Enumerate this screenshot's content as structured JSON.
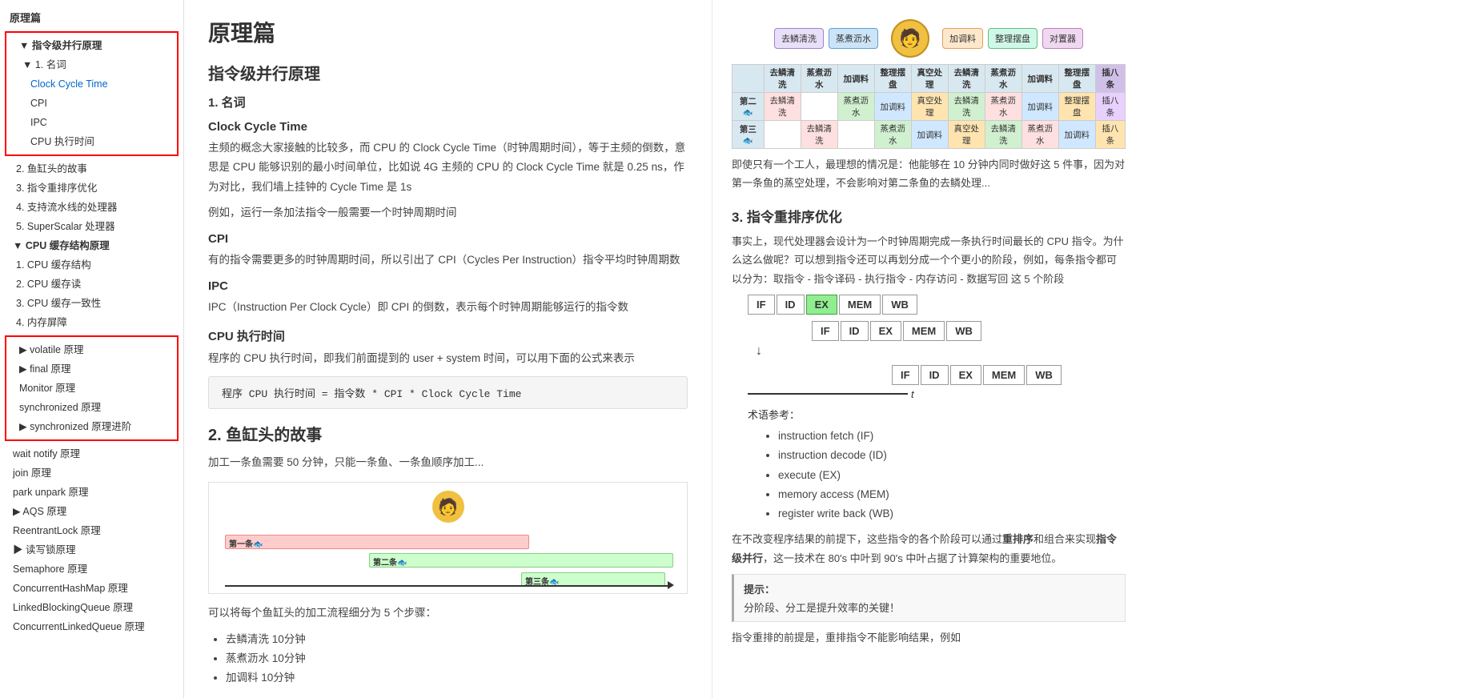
{
  "sidebar": {
    "top_title": "原理篇",
    "groups": [
      {
        "type": "outlined",
        "items": [
          {
            "label": "▼ 指令级并行原理",
            "indent": 0,
            "bold": true
          },
          {
            "label": "▼ 1. 名词",
            "indent": 1
          },
          {
            "label": "Clock Cycle Time",
            "indent": 2,
            "active": true
          },
          {
            "label": "CPI",
            "indent": 2
          },
          {
            "label": "IPC",
            "indent": 2
          },
          {
            "label": "CPU 执行时间",
            "indent": 2
          }
        ]
      }
    ],
    "plain_items": [
      {
        "label": "2. 鱼缸头的故事",
        "indent": 1
      },
      {
        "label": "3. 指令重排序优化",
        "indent": 1
      },
      {
        "label": "4. 支持流水线的处理器",
        "indent": 1
      },
      {
        "label": "5. SuperScalar 处理器",
        "indent": 1
      }
    ],
    "cpu_section": {
      "title": "▼ CPU 缓存结构原理",
      "items": [
        {
          "label": "1. CPU 缓存结构",
          "indent": 1
        },
        {
          "label": "2. CPU 缓存读",
          "indent": 1
        },
        {
          "label": "3. CPU 缓存一致性",
          "indent": 1
        },
        {
          "label": "4. 内存屏障",
          "indent": 1
        }
      ]
    },
    "outlined2_items": [
      {
        "label": "▶ volatile 原理",
        "indent": 0
      },
      {
        "label": "▶ final 原理",
        "indent": 0
      },
      {
        "label": "Monitor 原理",
        "indent": 0
      },
      {
        "label": "synchronized 原理",
        "indent": 0
      },
      {
        "label": "▶ synchronized 原理进阶",
        "indent": 0
      }
    ],
    "bottom_items": [
      {
        "label": "wait notify 原理",
        "indent": 0
      },
      {
        "label": "join 原理",
        "indent": 0
      },
      {
        "label": "park unpark 原理",
        "indent": 0
      },
      {
        "label": "▶ AQS 原理",
        "indent": 0
      },
      {
        "label": "ReentrantLock 原理",
        "indent": 0
      },
      {
        "label": "▶ 读写锁原理",
        "indent": 0
      },
      {
        "label": "Semaphore 原理",
        "indent": 0
      },
      {
        "label": "ConcurrentHashMap 原理",
        "indent": 0
      },
      {
        "label": "LinkedBlockingQueue 原理",
        "indent": 0
      },
      {
        "label": "ConcurrentLinkedQueue 原理",
        "indent": 0
      }
    ]
  },
  "main": {
    "page_title": "原理篇",
    "article_title": "指令级并行原理",
    "section1_title": "1. 名词",
    "sub1_title": "Clock Cycle Time",
    "sub1_para1": "主频的概念大家接触的比较多，而 CPU 的 Clock Cycle Time（时钟周期时间），等于主频的倒数，意思是 CPU 能够识别的最小时间单位，比如说 4G 主频的 CPU 的 Clock Cycle Time 就是 0.25 ns，作为对比，我们墙上挂钟的 Cycle Time 是 1s",
    "sub1_para2": "例如，运行一条加法指令一般需要一个时钟周期时间",
    "sub2_title": "CPI",
    "sub2_para": "有的指令需要更多的时钟周期时间，所以引出了 CPI（Cycles Per Instruction）指令平均时钟周期数",
    "sub3_title": "IPC",
    "sub3_para": "IPC（Instruction Per Clock Cycle）即 CPI 的倒数，表示每个时钟周期能够运行的指令数",
    "sub4_title": "CPU 执行时间",
    "sub4_para": "程序的 CPU 执行时间，即我们前面提到的 user + system 时间，可以用下面的公式来表示",
    "code_formula": "程序 CPU 执行时间 = 指令数 * CPI * Clock Cycle Time",
    "section2_title": "2. 鱼缸头的故事",
    "section2_para": "加工一条鱼需要 50 分钟，只能一条鱼、一条鱼顺序加工...",
    "bar1_label": "第一条🐟",
    "bar2_label": "第二条🐟",
    "bar3_label": "第三条🐟",
    "section2_para2": "可以将每个鱼缸头的加工流程细分为 5 个步骤：",
    "steps": [
      "去鳞清洗 10分钟",
      "蒸煮沥水 10分钟",
      "加调料 10分钟"
    ]
  },
  "right": {
    "diagram_caption": "即使只有一个工人，最理想的情况是：他能够在 10 分钟内同时做好这 5 件事，因为对第一条鱼的蒸空处理，不会影响对第二条鱼的去鳞处理...",
    "section3_title": "3. 指令重排序优化",
    "section3_para1": "事实上，现代处理器会设计为一个时钟周期完成一条执行时间最长的 CPU 指令。为什么这么做呢？可以想到指令还可以再划分成一个个更小的阶段，例如，每条指令都可以分为：取指令 - 指令译码 - 执行指令 - 内存访问 - 数据写回 这 5 个阶段",
    "stages": [
      "IF",
      "ID",
      "EX",
      "MEM",
      "WB"
    ],
    "stage_highlighted": "EX",
    "term_label": "术语参考：",
    "terms": [
      "instruction fetch (IF)",
      "instruction decode (ID)",
      "execute (EX)",
      "memory access (MEM)",
      "register write back (WB)"
    ],
    "section3_para2": "在不改变程序结果的前提下，这些指令的各个阶段可以通过重排序和组合来实现指令级并行，这一技术在 80's 中叶到 90's 中叶占据了计算架构的重要地位。",
    "tip_title": "提示：",
    "tip_content": "分阶段、分工是提升效率的关键！",
    "section3_para3": "指令重排的前提是，重排指令不能影响结果，例如"
  }
}
